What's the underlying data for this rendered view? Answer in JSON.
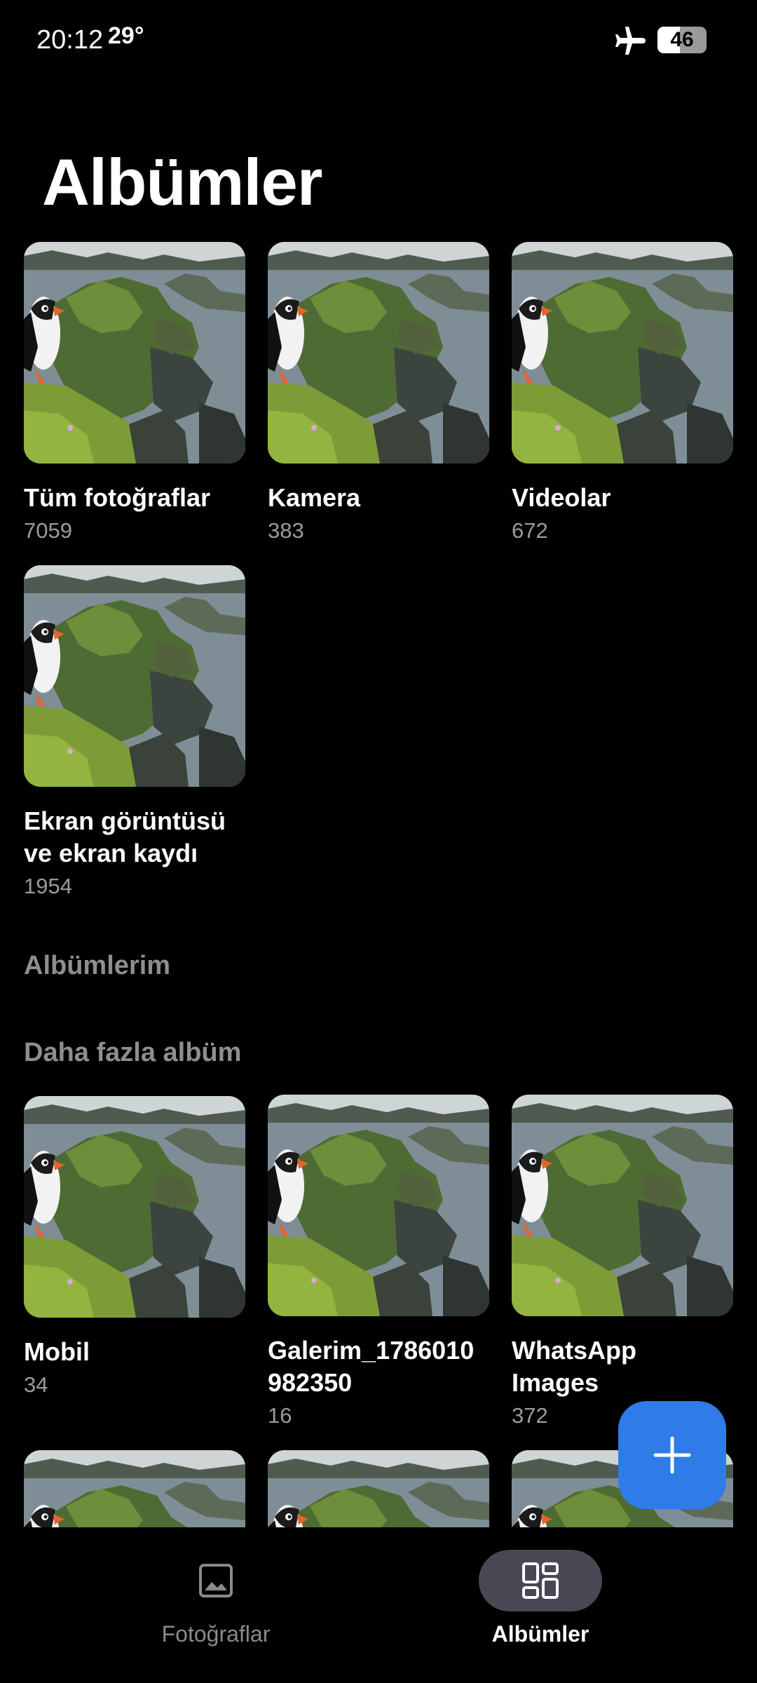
{
  "status": {
    "time": "20:12",
    "temperature": "29°",
    "battery": "46",
    "battery_level": 0.46,
    "airplane_icon": "airplane-icon"
  },
  "page": {
    "title": "Albümler"
  },
  "main_albums": [
    {
      "name": "Tüm fotoğraflar",
      "count": "7059"
    },
    {
      "name": "Kamera",
      "count": "383"
    },
    {
      "name": "Videolar",
      "count": "672"
    },
    {
      "name": "Ekran görüntüsü\nve ekran kaydı",
      "count": "1954"
    }
  ],
  "sections": {
    "my_albums": "Albümlerim",
    "more_albums": "Daha fazla albüm"
  },
  "more_albums": [
    {
      "name": "Mobil",
      "count": "34"
    },
    {
      "name": "Galerim_1786010\n982350",
      "count": "16"
    },
    {
      "name": "WhatsApp\nImages",
      "count": "372"
    }
  ],
  "fab": {
    "icon": "plus-icon"
  },
  "nav": {
    "photos_label": "Fotoğraflar",
    "photos_icon": "image-icon",
    "albums_label": "Albümler",
    "albums_icon": "grid-icon"
  },
  "colors": {
    "accent": "#2f7be8",
    "background": "#000000",
    "secondary_text": "#9b9b9b",
    "nav_active_bg": "#4a4654"
  }
}
